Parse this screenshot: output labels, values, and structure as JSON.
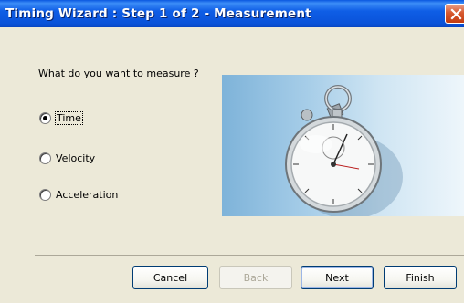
{
  "window": {
    "title": "Timing Wizard : Step 1 of 2 - Measurement"
  },
  "question": "What do you want to measure ?",
  "options": [
    {
      "label": "Time",
      "selected": true
    },
    {
      "label": "Velocity",
      "selected": false
    },
    {
      "label": "Acceleration",
      "selected": false
    }
  ],
  "buttons": {
    "cancel": "Cancel",
    "back": "Back",
    "next": "Next",
    "finish": "Finish"
  },
  "colors": {
    "titlebar": "#0A53D9",
    "dialog_bg": "#ECE9D8",
    "close_button": "#C23B10"
  },
  "icons": {
    "close": "close-icon",
    "image": "stopwatch-icon"
  }
}
